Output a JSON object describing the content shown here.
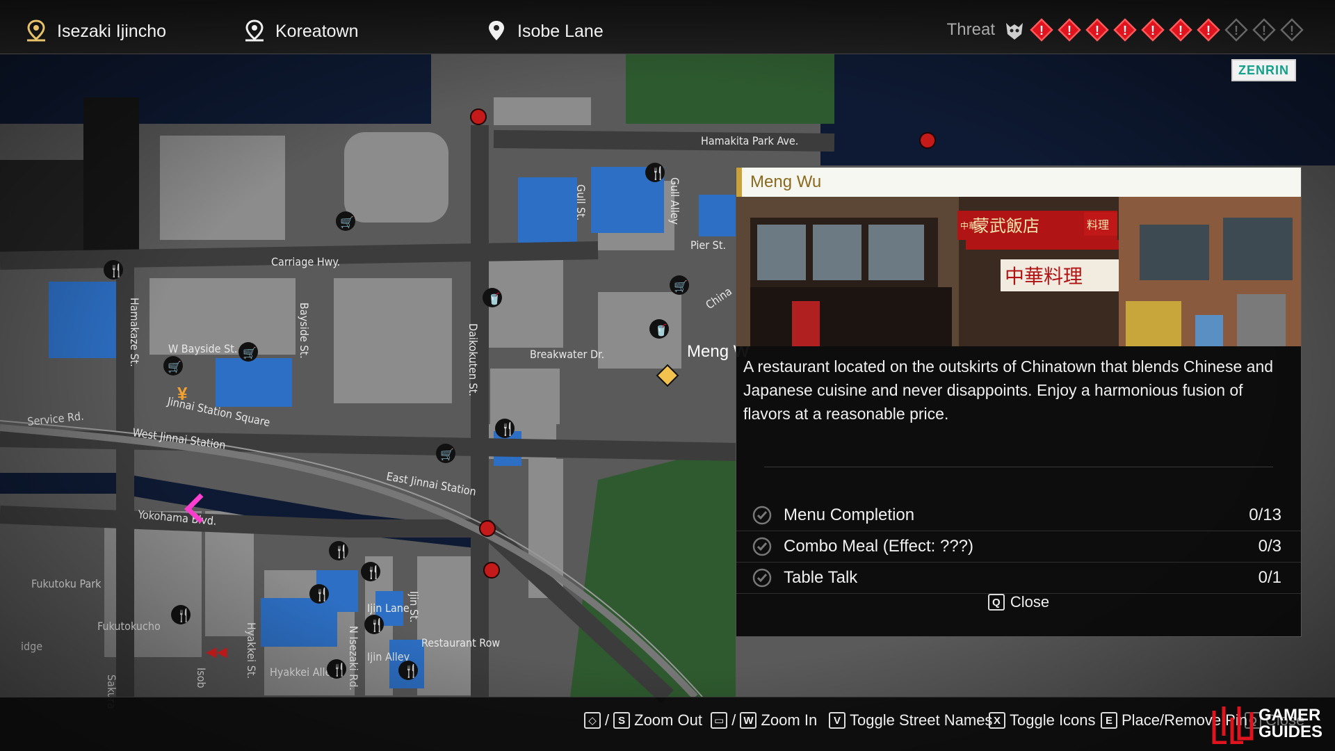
{
  "topbar": {
    "locations": [
      {
        "label": "Isezaki Ijincho",
        "icon": "area-pin-icon"
      },
      {
        "label": "Koreatown",
        "icon": "area-pin-icon"
      },
      {
        "label": "Isobe Lane",
        "icon": "location-pin-icon"
      }
    ],
    "threat": {
      "label": "Threat",
      "level": 7,
      "max": 10,
      "active_color": "#e0141e",
      "inactive_color": "#666666"
    }
  },
  "map": {
    "attribution": "ZENRIN",
    "streets": [
      "Hamakita Park Ave.",
      "Gull St.",
      "Gull Alley",
      "Pier St.",
      "China",
      "Carriage Hwy.",
      "Bayside St.",
      "Hamakaze St.",
      "W Bayside St.",
      "Daikokuten St.",
      "Breakwater Dr.",
      "Jinnai Station Square",
      "West Jinnai Station",
      "Service Rd.",
      "East Jinnai Station",
      "Yokohama Blvd.",
      "Fukutoku Park",
      "Fukutokucho",
      "Hyakkei St.",
      "Ijin Lane",
      "Ijin St.",
      "Restaurant Row",
      "N Isezaki Rd.",
      "Ijin Alley",
      "Hyakkei Alley",
      "Sakura",
      "Isob",
      "idge"
    ],
    "selected_marker_label": "Meng W"
  },
  "panel": {
    "title": "Meng Wu",
    "description": "A restaurant located on the outskirts of Chinatown that blends Chinese and Japanese cuisine and never disappoints. Enjoy a harmonious fusion of flavors at a reasonable price.",
    "photo_signs": {
      "main": "蒙武飯店",
      "sub": "中華料理",
      "corner": "料理",
      "small": "中華"
    },
    "tasks": [
      {
        "label": "Menu Completion",
        "value": "0/13"
      },
      {
        "label": "Combo Meal (Effect: ???)",
        "value": "0/3"
      },
      {
        "label": "Table Talk",
        "value": "0/1"
      }
    ],
    "close": {
      "key": "Q",
      "label": "Close"
    }
  },
  "bottombar": {
    "hints": [
      {
        "keys": [
          "◇",
          "S"
        ],
        "label": "Zoom Out"
      },
      {
        "keys": [
          "▭",
          "W"
        ],
        "label": "Zoom In"
      },
      {
        "keys": [
          "V"
        ],
        "label": "Toggle Street Names"
      },
      {
        "keys": [
          "X"
        ],
        "label": "Toggle Icons"
      },
      {
        "keys": [
          "E"
        ],
        "label": "Place/Remove Pin"
      },
      {
        "keys": [
          "Q"
        ],
        "label": "Close"
      }
    ]
  },
  "watermark": {
    "line1": "GAMER",
    "line2": "GUIDES"
  }
}
